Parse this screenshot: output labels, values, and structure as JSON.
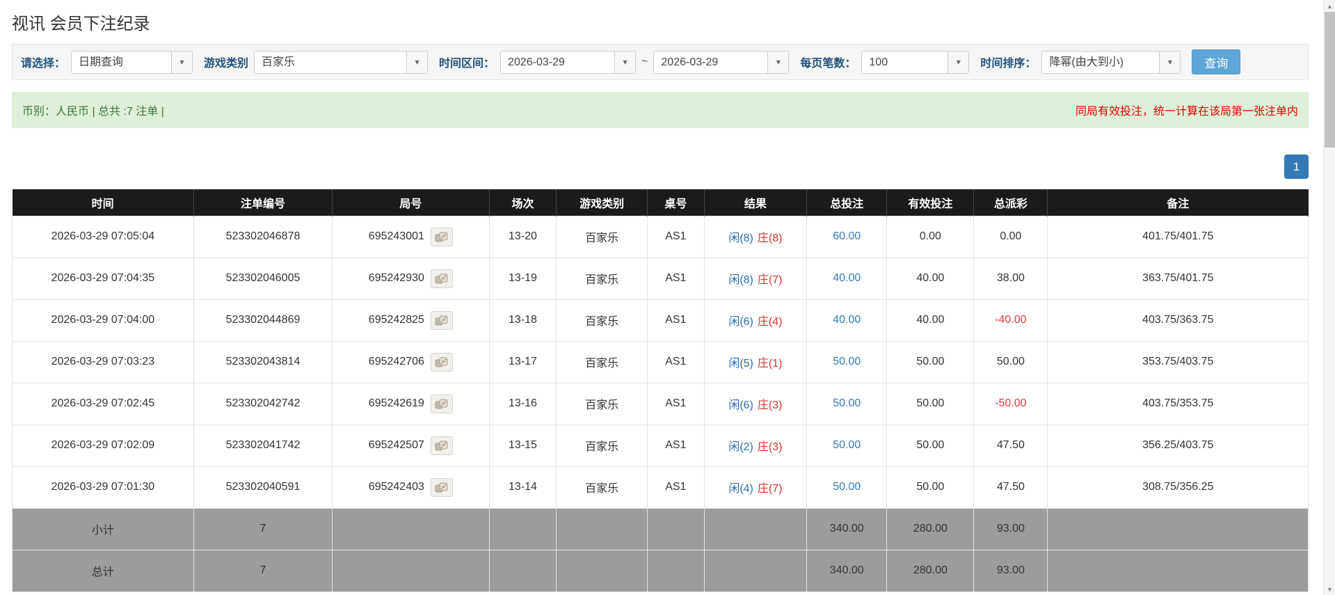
{
  "page": {
    "title": "视讯 会员下注纪录"
  },
  "filters": {
    "select_label": "请选择：",
    "select_value": "日期查询",
    "game_type_label": "游戏类别",
    "game_type_value": "百家乐",
    "time_range_label": "时间区间：",
    "time_from": "2026-03-29",
    "range_separator": "~",
    "time_to": "2026-03-29",
    "page_size_label": "每页笔数：",
    "page_size_value": "100",
    "sort_label": "时间排序：",
    "sort_value": "降幂(由大到小)",
    "search_button": "查询"
  },
  "summary": {
    "currency_info": "币别：人民币 | 总共 :7 注单 |",
    "notice": "同局有效投注，统一计算在该局第一张注单内"
  },
  "pagination": {
    "current_page": "1"
  },
  "table": {
    "headers": [
      "时间",
      "注单编号",
      "局号",
      "场次",
      "游戏类别",
      "桌号",
      "结果",
      "总投注",
      "有效投注",
      "总派彩",
      "备注"
    ],
    "rows": [
      {
        "time": "2026-03-29 07:05:04",
        "bet_id": "523302046878",
        "round": "695243001",
        "session": "13-20",
        "game": "百家乐",
        "table": "AS1",
        "result_player": "闲(8)",
        "result_banker": "庄(8)",
        "total_bet": "60.00",
        "valid_bet": "0.00",
        "payout": "0.00",
        "note": "401.75/401.75"
      },
      {
        "time": "2026-03-29 07:04:35",
        "bet_id": "523302046005",
        "round": "695242930",
        "session": "13-19",
        "game": "百家乐",
        "table": "AS1",
        "result_player": "闲(8)",
        "result_banker": "庄(7)",
        "total_bet": "40.00",
        "valid_bet": "40.00",
        "payout": "38.00",
        "note": "363.75/401.75"
      },
      {
        "time": "2026-03-29 07:04:00",
        "bet_id": "523302044869",
        "round": "695242825",
        "session": "13-18",
        "game": "百家乐",
        "table": "AS1",
        "result_player": "闲(6)",
        "result_banker": "庄(4)",
        "total_bet": "40.00",
        "valid_bet": "40.00",
        "payout": "-40.00",
        "note": "403.75/363.75"
      },
      {
        "time": "2026-03-29 07:03:23",
        "bet_id": "523302043814",
        "round": "695242706",
        "session": "13-17",
        "game": "百家乐",
        "table": "AS1",
        "result_player": "闲(5)",
        "result_banker": "庄(1)",
        "total_bet": "50.00",
        "valid_bet": "50.00",
        "payout": "50.00",
        "note": "353.75/403.75"
      },
      {
        "time": "2026-03-29 07:02:45",
        "bet_id": "523302042742",
        "round": "695242619",
        "session": "13-16",
        "game": "百家乐",
        "table": "AS1",
        "result_player": "闲(6)",
        "result_banker": "庄(3)",
        "total_bet": "50.00",
        "valid_bet": "50.00",
        "payout": "-50.00",
        "note": "403.75/353.75"
      },
      {
        "time": "2026-03-29 07:02:09",
        "bet_id": "523302041742",
        "round": "695242507",
        "session": "13-15",
        "game": "百家乐",
        "table": "AS1",
        "result_player": "闲(2)",
        "result_banker": "庄(3)",
        "total_bet": "50.00",
        "valid_bet": "50.00",
        "payout": "47.50",
        "note": "356.25/403.75"
      },
      {
        "time": "2026-03-29 07:01:30",
        "bet_id": "523302040591",
        "round": "695242403",
        "session": "13-14",
        "game": "百家乐",
        "table": "AS1",
        "result_player": "闲(4)",
        "result_banker": "庄(7)",
        "total_bet": "50.00",
        "valid_bet": "50.00",
        "payout": "47.50",
        "note": "308.75/356.25"
      }
    ],
    "subtotal": {
      "label": "小计",
      "count": "7",
      "total_bet": "340.00",
      "valid_bet": "280.00",
      "payout": "93.00"
    },
    "total": {
      "label": "总计",
      "count": "7",
      "total_bet": "340.00",
      "valid_bet": "280.00",
      "payout": "93.00"
    }
  },
  "icons": {
    "chevron_down": "▾",
    "scroll_up": "▲",
    "scroll_down": "▼"
  },
  "theme": {
    "accent_blue": "#337ab7",
    "button_blue": "#5ca6d8",
    "player_blue": "#2b6cb0",
    "banker_red": "#d9342b",
    "negative_red": "#e4393c",
    "success_bg": "#dff0d8",
    "success_text": "#3c763d",
    "notice_red": "#e60000",
    "table_header_bg": "#1b1b1b",
    "summary_row_bg": "#9c9c9c"
  }
}
